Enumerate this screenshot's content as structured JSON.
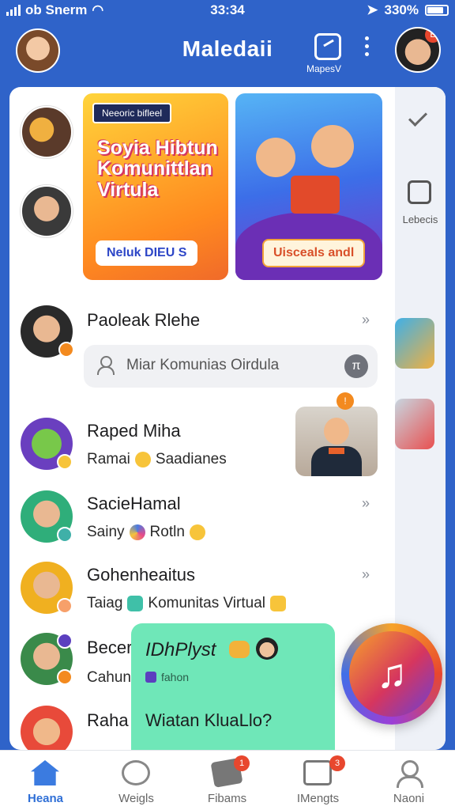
{
  "status_bar": {
    "carrier": "ob Snerm",
    "time": "33:34",
    "battery": "330%",
    "battery_level": 0.85
  },
  "header": {
    "title": "Maledaii",
    "compose_label": "MapesV",
    "profile_badge": "E"
  },
  "side_panel": {
    "label": "Lebecis"
  },
  "banners": [
    {
      "tag": "Neeoric bifleel",
      "headline": "Soyia Hibtun Komunittlan Virtula",
      "cta": "Neluk DIEU S"
    },
    {
      "cta": "Uisceals andl"
    }
  ],
  "search": {
    "row_name": "Paoleak Rlehe",
    "placeholder": "Miar Komunias Oirdula",
    "button": "π"
  },
  "conversations": [
    {
      "name": "Raped Miha",
      "sub1": "Ramai",
      "sub2": "Saadianes",
      "thumb_badge": "!"
    },
    {
      "name": "SacieHamal",
      "sub1": "Sainy",
      "sub2": "Rotln"
    },
    {
      "name": "Gohenheaitus",
      "sub1": "Taiag",
      "sub2": "Komunitas Virtual"
    },
    {
      "name": "Becer",
      "sub1": "Cahun"
    },
    {
      "name": "Raha"
    }
  ],
  "popup": {
    "title": "IDhPlyst",
    "sub": "fahon",
    "message": "Wiatan KluaLlo?"
  },
  "fab": {
    "icon": "♫"
  },
  "nav": {
    "items": [
      {
        "label": "Heana",
        "icon": "home-icon"
      },
      {
        "label": "Weigls",
        "icon": "chat-icon"
      },
      {
        "label": "Fibams",
        "icon": "camera-icon",
        "badge": "1"
      },
      {
        "label": "IMengts",
        "icon": "image-icon",
        "badge": "3"
      },
      {
        "label": "Naoni",
        "icon": "user-icon"
      }
    ]
  }
}
